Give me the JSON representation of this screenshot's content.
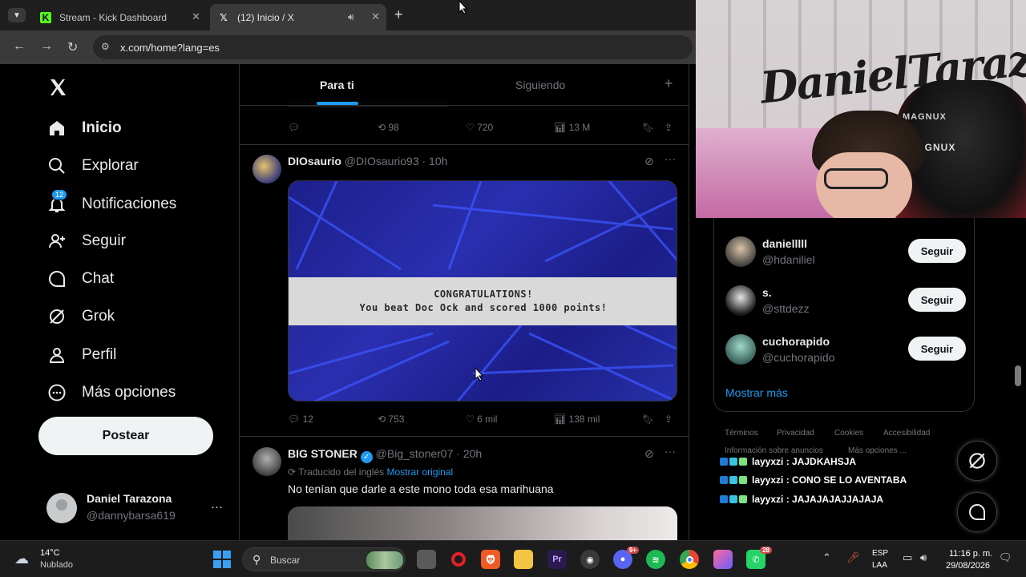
{
  "browser": {
    "tabs": [
      {
        "title": "Stream - Kick Dashboard",
        "icon": "kick-icon"
      },
      {
        "title": "(12) Inicio / X",
        "icon": "x-logo-icon"
      }
    ],
    "url": "x.com/home?lang=es"
  },
  "nav": {
    "items": [
      {
        "label": "Inicio",
        "icon": "home-icon"
      },
      {
        "label": "Explorar",
        "icon": "search-icon"
      },
      {
        "label": "Notificaciones",
        "icon": "bell-icon",
        "badge": "12"
      },
      {
        "label": "Seguir",
        "icon": "add-person-icon"
      },
      {
        "label": "Chat",
        "icon": "chat-bubble-icon"
      },
      {
        "label": "Grok",
        "icon": "grok-icon"
      },
      {
        "label": "Perfil",
        "icon": "person-icon"
      },
      {
        "label": "Más opciones",
        "icon": "more-circle-icon"
      }
    ],
    "post_label": "Postear",
    "account": {
      "name": "Daniel Tarazona",
      "handle": "@dannybarsa619",
      "more": "···"
    }
  },
  "timeline": {
    "tabs": {
      "for_you": "Para ti",
      "following": "Siguiendo"
    },
    "top_tweet_actions": {
      "retweets": "98",
      "likes": "720",
      "views": "13 M"
    },
    "tweets": [
      {
        "name": "DIOsaurio",
        "handle": "@DIOsaurio93",
        "time": "· 10h",
        "media_text": [
          "CONGRATULATIONS!",
          "You beat Doc Ock and scored 1000 points!"
        ],
        "replies": "12",
        "retweets": "753",
        "likes": "6 mil",
        "views": "138 mil"
      },
      {
        "name": "BIG STONER",
        "handle": "@Big_stoner07",
        "time": "· 20h",
        "translated": "Traducido del inglés",
        "show_original": "Mostrar original",
        "text": "No tenían que darle a este mono toda esa marihuana"
      }
    ]
  },
  "who_to_follow": {
    "users": [
      {
        "name": "danielllll",
        "handle": "@hdaniliel",
        "button": "Seguir"
      },
      {
        "name": "s.",
        "handle": "@sttdezz",
        "button": "Seguir"
      },
      {
        "name": "cuchorapido",
        "handle": "@cuchorapido",
        "button": "Seguir"
      }
    ],
    "show_more": "Mostrar más"
  },
  "footer_links": [
    "Términos",
    "Privacidad",
    "Cookies",
    "Accesibilidad",
    "Información sobre anuncios",
    "Más opciones ..."
  ],
  "stream_chat": [
    {
      "user": "layyxzi",
      "message": "JAJDKAHSJA"
    },
    {
      "user": "layyxzi",
      "message": "CONO SE LO AVENTABA"
    },
    {
      "user": "layyxzi",
      "message": "JAJAJAJAJJAJAJA"
    }
  ],
  "webcam": {
    "graffiti": "DanielTaraz",
    "chair_brand": "MAGNUX"
  },
  "taskbar": {
    "weather_temp": "14°C",
    "weather_desc": "Nublado",
    "search_placeholder": "Buscar",
    "discord_badge": "9+",
    "whatsapp_badge": "28",
    "lang_line1": "ESP",
    "lang_line2": "LAA",
    "time": "11:16 p. m.",
    "date": "29/08/2026"
  },
  "colors": {
    "accent": "#1d9bf0",
    "verified": "#1d9bf0",
    "text": "#e7e9ea",
    "muted": "#71767b",
    "border": "#2f3336"
  }
}
